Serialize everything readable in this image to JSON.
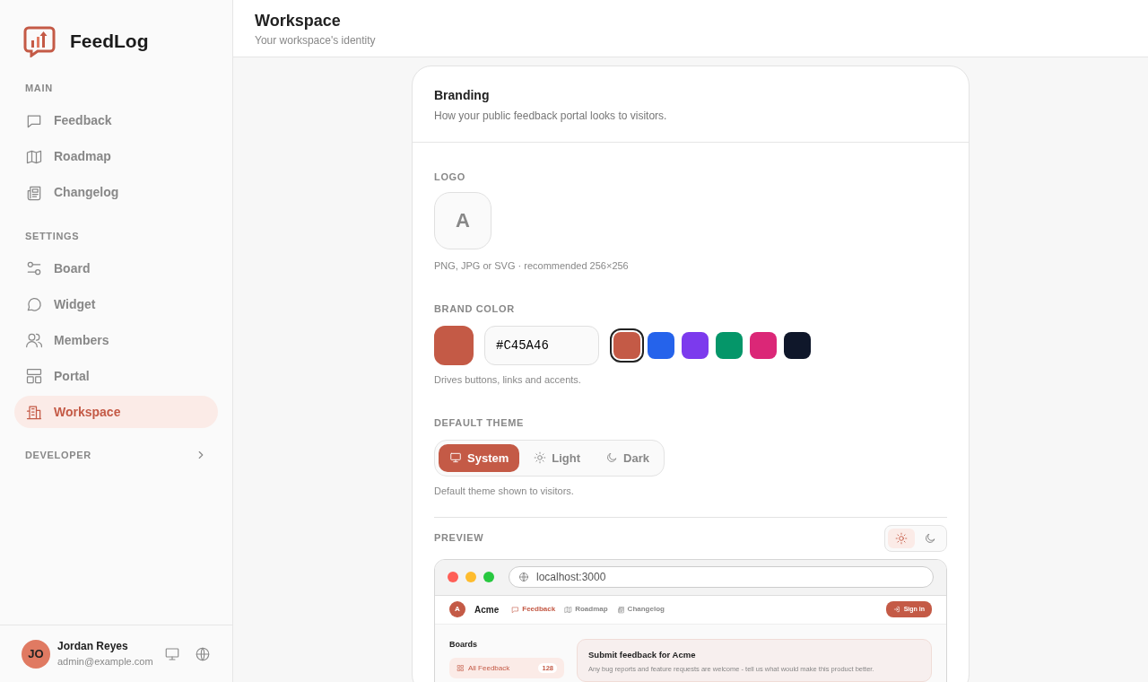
{
  "brand": {
    "name": "FeedLog"
  },
  "sidebar": {
    "sections": [
      {
        "title": "MAIN",
        "items": [
          {
            "label": "Feedback",
            "selected": false
          },
          {
            "label": "Roadmap",
            "selected": false
          },
          {
            "label": "Changelog",
            "selected": false
          }
        ]
      },
      {
        "title": "SETTINGS",
        "items": [
          {
            "label": "Board",
            "selected": false
          },
          {
            "label": "Widget",
            "selected": false
          },
          {
            "label": "Members",
            "selected": false
          },
          {
            "label": "Portal",
            "selected": false
          },
          {
            "label": "Workspace",
            "selected": true
          }
        ]
      },
      {
        "title": "DEVELOPER"
      }
    ]
  },
  "user": {
    "initials": "JO",
    "name": "Jordan Reyes",
    "email": "admin@example.com"
  },
  "header": {
    "title": "Workspace",
    "subtitle": "Your workspace's identity"
  },
  "card": {
    "title": "Branding",
    "subtitle": "How your public feedback portal looks to visitors.",
    "logo": {
      "label": "LOGO",
      "letter": "A",
      "hint": "PNG, JPG or SVG · recommended 256×256"
    },
    "brand_color": {
      "label": "BRAND COLOR",
      "value": "#C45A46",
      "color": "#c45a46",
      "hint": "Drives buttons, links and accents.",
      "swatches": [
        {
          "color": "#c45a46",
          "selected": true
        },
        {
          "color": "#2563eb",
          "selected": false
        },
        {
          "color": "#7c3aed",
          "selected": false
        },
        {
          "color": "#059669",
          "selected": false
        },
        {
          "color": "#db2777",
          "selected": false
        },
        {
          "color": "#0f172a",
          "selected": false
        }
      ]
    },
    "theme": {
      "label": "DEFAULT THEME",
      "options": [
        {
          "label": "System",
          "selected": true
        },
        {
          "label": "Light",
          "selected": false
        },
        {
          "label": "Dark",
          "selected": false
        }
      ],
      "hint": "Default theme shown to visitors."
    },
    "preview": {
      "label": "PREVIEW",
      "modes": [
        {
          "selected": true
        },
        {
          "selected": false
        }
      ],
      "url": "localhost:3000",
      "site": {
        "letter": "A",
        "name": "Acme",
        "nav": [
          {
            "label": "Feedback",
            "selected": true
          },
          {
            "label": "Roadmap",
            "selected": false
          },
          {
            "label": "Changelog",
            "selected": false
          }
        ],
        "signin": "Sign in",
        "boards_title": "Boards",
        "boards": [
          {
            "label": "All Feedback",
            "count": "128",
            "selected": true
          }
        ],
        "hero_title": "Submit feedback for Acme",
        "hero_text": "Any bug reports and feature requests are welcome - tell us what would make this product better."
      }
    }
  }
}
